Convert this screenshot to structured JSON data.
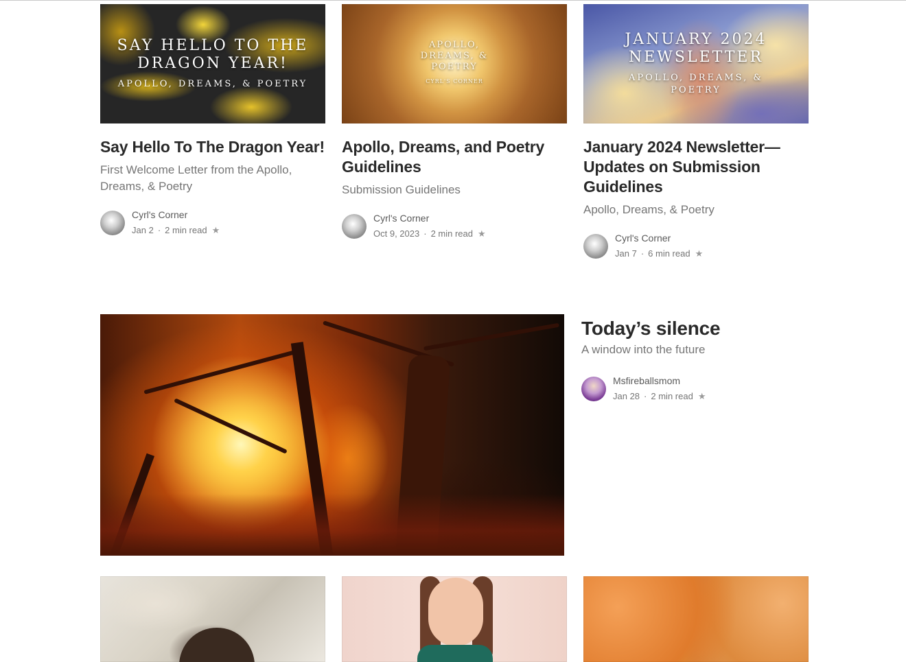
{
  "top_row": [
    {
      "image_title": "SAY HELLO TO THE DRAGON YEAR!",
      "image_subtitle": "APOLLO, DREAMS, & POETRY",
      "title": "Say Hello To The Dragon Year!",
      "subtitle": "First Welcome Letter from the Apollo, Dreams, & Poetry",
      "author": "Cyrl's Corner",
      "date": "Jan 2",
      "read_time": "2 min read"
    },
    {
      "image_title": "APOLLO, DREAMS, & POETRY",
      "image_subtitle": "CYRL'S CORNER",
      "title": "Apollo, Dreams, and Poetry Guidelines",
      "subtitle": "Submission Guidelines",
      "author": "Cyrl's Corner",
      "date": "Oct 9, 2023",
      "read_time": "2 min read"
    },
    {
      "image_title": "JANUARY 2024 NEWSLETTER",
      "image_subtitle": "APOLLO, DREAMS, & POETRY",
      "title": "January 2024 Newsletter—Updates on Submission Guidelines",
      "subtitle": "Apollo, Dreams, & Poetry",
      "author": "Cyrl's Corner",
      "date": "Jan 7",
      "read_time": "6 min read"
    }
  ],
  "featured": {
    "title": "Today’s silence",
    "subtitle": "A window into the future",
    "author": "Msfireballsmom",
    "date": "Jan 28",
    "read_time": "2 min read"
  },
  "meta_separator": "·",
  "member_star": "★",
  "colors": {
    "title_text": "#292929",
    "secondary_text": "#757575",
    "background": "#ffffff"
  }
}
